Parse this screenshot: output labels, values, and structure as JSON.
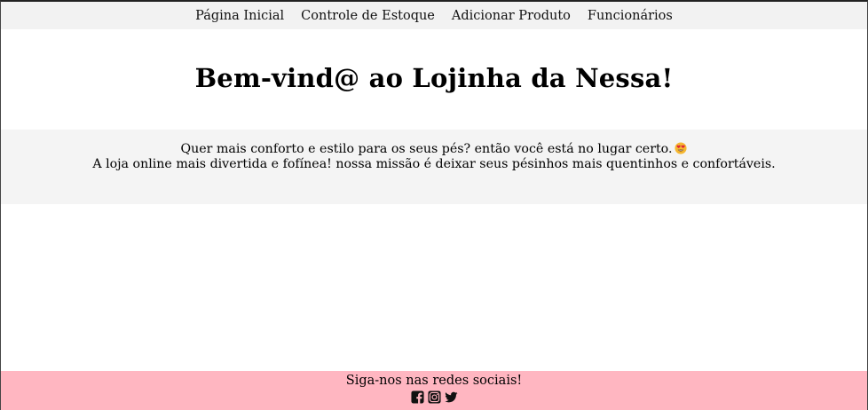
{
  "nav": {
    "items": [
      "Página Inicial",
      "Controle de Estoque",
      "Adicionar Produto",
      "Funcionários"
    ]
  },
  "hero": {
    "title": "Bem-vind@ ao Lojinha da Nessa!"
  },
  "intro": {
    "line1": "Quer mais conforto e estilo para os seus pés? então você está no lugar certo.",
    "line1_emoji": "heart-eyes-emoji",
    "line2": "A loja online mais divertida e fofínea! nossa missão é deixar seus pésinhos mais quentinhos e confortáveis."
  },
  "footer": {
    "text": "Siga-nos nas redes sociais!",
    "icons": [
      "facebook-icon",
      "instagram-icon",
      "twitter-icon"
    ],
    "background": "#ffb6c1"
  },
  "colors": {
    "nav_bg": "#f2f2f2",
    "intro_bg": "#f4f4f4",
    "footer_bg": "#ffb6c1"
  }
}
